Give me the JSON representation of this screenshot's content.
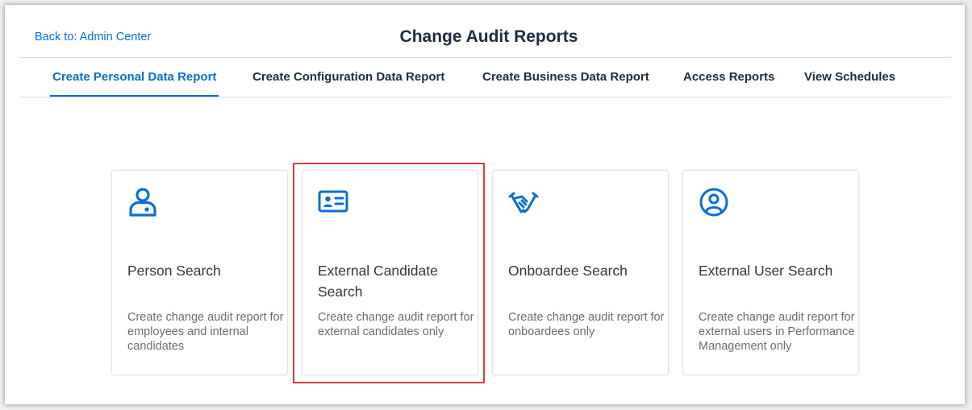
{
  "header": {
    "back_link": "Back to: Admin Center",
    "title": "Change Audit Reports"
  },
  "tabs": [
    {
      "label": "Create Personal Data Report",
      "active": true
    },
    {
      "label": "Create Configuration Data Report",
      "active": false
    },
    {
      "label": "Create Business Data Report",
      "active": false
    },
    {
      "label": "Access Reports",
      "active": false
    },
    {
      "label": "View Schedules",
      "active": false
    }
  ],
  "cards": [
    {
      "icon": "person-search-icon",
      "title": "Person Search",
      "description": "Create change audit report for employees and internal candidates"
    },
    {
      "icon": "id-card-icon",
      "title": "External Candidate Search",
      "description": "Create change audit report for external candidates only"
    },
    {
      "icon": "handshake-icon",
      "title": "Onboardee Search",
      "description": "Create change audit report for onboardees only"
    },
    {
      "icon": "user-circle-icon",
      "title": "External User Search",
      "description": "Create change audit report for external users in Performance Management only"
    }
  ],
  "colors": {
    "accent": "#0a6ed1",
    "highlight": "#e0393e",
    "title_text": "#1d2d3e"
  }
}
